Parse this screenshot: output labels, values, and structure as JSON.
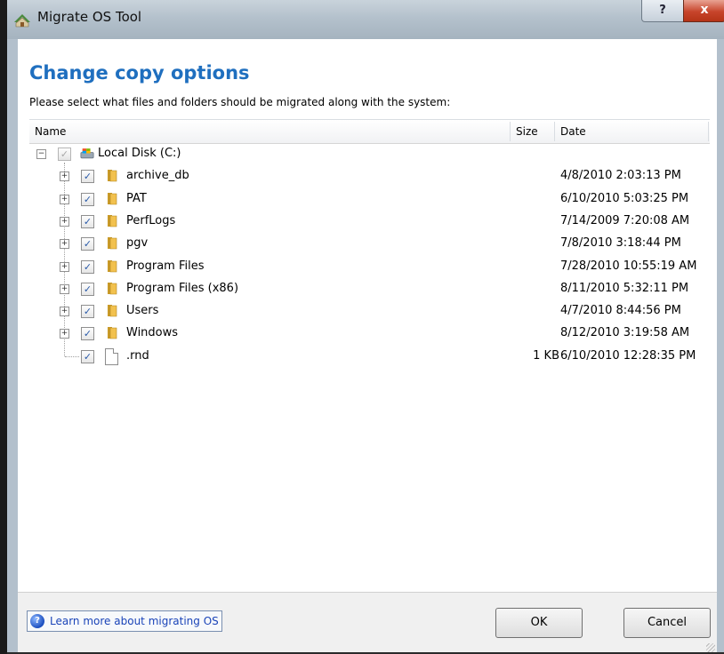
{
  "window": {
    "title": "Migrate OS Tool",
    "help_button": "?",
    "close_button": "x"
  },
  "page": {
    "heading": "Change copy options",
    "subtitle": "Please select what files and folders should be migrated along with the system:"
  },
  "list": {
    "columns": {
      "name": "Name",
      "size": "Size",
      "date": "Date"
    },
    "root": {
      "label": "Local Disk (C:)",
      "checked": true,
      "expanded": true,
      "icon": "drive-icon"
    },
    "items": [
      {
        "label": "archive_db",
        "type": "folder",
        "size": "",
        "date": "4/8/2010 2:03:13 PM",
        "checked": true
      },
      {
        "label": "PAT",
        "type": "folder",
        "size": "",
        "date": "6/10/2010 5:03:25 PM",
        "checked": true
      },
      {
        "label": "PerfLogs",
        "type": "folder",
        "size": "",
        "date": "7/14/2009 7:20:08 AM",
        "checked": true
      },
      {
        "label": "pgv",
        "type": "folder",
        "size": "",
        "date": "7/8/2010 3:18:44 PM",
        "checked": true
      },
      {
        "label": "Program Files",
        "type": "folder",
        "size": "",
        "date": "7/28/2010 10:55:19 AM",
        "checked": true
      },
      {
        "label": "Program Files (x86)",
        "type": "folder",
        "size": "",
        "date": "8/11/2010 5:32:11 PM",
        "checked": true
      },
      {
        "label": "Users",
        "type": "folder",
        "size": "",
        "date": "4/7/2010 8:44:56 PM",
        "checked": true
      },
      {
        "label": "Windows",
        "type": "folder",
        "size": "",
        "date": "8/12/2010 3:19:58 AM",
        "checked": true
      },
      {
        "label": ".rnd",
        "type": "file",
        "size": "1 KB",
        "date": "6/10/2010 12:28:35 PM",
        "checked": true
      }
    ]
  },
  "footer": {
    "help_link": "Learn more about migrating OS",
    "ok_label": "OK",
    "cancel_label": "Cancel"
  },
  "colors": {
    "heading": "#1f6fbf",
    "link": "#1a44b8",
    "folder": "#f2c14e",
    "close_button": "#c7442b"
  }
}
